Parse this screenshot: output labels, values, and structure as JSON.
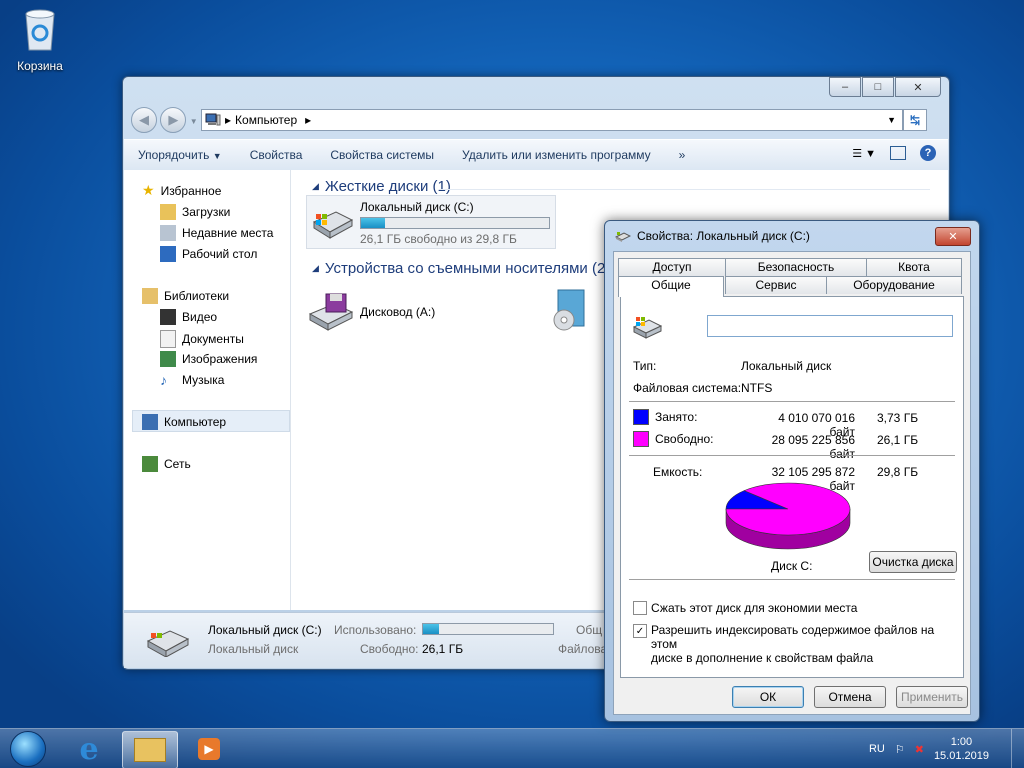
{
  "desktop": {
    "recycle_bin_label": "Корзина"
  },
  "explorer": {
    "address": {
      "computer_label": "Компьютер"
    },
    "toolbar": {
      "organize": "Упорядочить",
      "properties": "Свойства",
      "system_properties": "Свойства системы",
      "uninstall": "Удалить или изменить программу",
      "more": "»"
    },
    "sidebar": {
      "favorites": "Избранное",
      "downloads": "Загрузки",
      "recent": "Недавние места",
      "desktop": "Рабочий стол",
      "libraries": "Библиотеки",
      "video": "Видео",
      "documents": "Документы",
      "images": "Изображения",
      "music": "Музыка",
      "computer": "Компьютер",
      "network": "Сеть"
    },
    "groups": {
      "hard_disks": "Жесткие диски (1)",
      "removable": "Устройства со съемными носителями (2)"
    },
    "local_disk": {
      "name": "Локальный диск (C:)",
      "free_text": "26,1 ГБ свободно из 29,8 ГБ",
      "used_fraction": 0.125
    },
    "floppy": {
      "name": "Дисковод (A:)"
    },
    "details": {
      "name": "Локальный диск (C:)",
      "type": "Локальный диск",
      "used_label": "Использовано:",
      "free_label": "Свободно:",
      "free_value": "26,1 ГБ",
      "total_label_cut": "Общ",
      "fs_label_cut": "Файлова",
      "used_fraction": 0.125
    }
  },
  "dialog": {
    "title": "Свойства: Локальный диск (C:)",
    "tabs_row1": [
      "Доступ",
      "Безопасность",
      "Квота"
    ],
    "tabs_row2": [
      "Общие",
      "Сервис",
      "Оборудование"
    ],
    "name_value": "",
    "type_label": "Тип:",
    "type_value": "Локальный диск",
    "fs_label": "Файловая система:",
    "fs_value": "NTFS",
    "used_label": "Занято:",
    "used_bytes": "4 010 070 016 байт",
    "used_gb": "3,73 ГБ",
    "free_label": "Свободно:",
    "free_bytes": "28 095 225 856 байт",
    "free_gb": "26,1 ГБ",
    "capacity_label": "Емкость:",
    "capacity_bytes": "32 105 295 872 байт",
    "capacity_gb": "29,8 ГБ",
    "disk_label": "Диск C:",
    "cleanup_button": "Очистка диска",
    "compress_label": "Сжать этот диск для экономии места",
    "index_label_line1": "Разрешить индексировать содержимое файлов на этом",
    "index_label_line2": "диске в дополнение к свойствам файла",
    "ok": "ОК",
    "cancel": "Отмена",
    "apply": "Применить",
    "used_color": "#0000ff",
    "free_color": "#ff00ff"
  },
  "chart_data": {
    "type": "pie",
    "slices": [
      {
        "name": "Занято",
        "value": 3.73,
        "color": "#0000ff"
      },
      {
        "name": "Свободно",
        "value": 26.1,
        "color": "#ff00ff"
      }
    ]
  },
  "taskbar": {
    "lang": "RU",
    "time": "1:00",
    "date": "15.01.2019"
  }
}
